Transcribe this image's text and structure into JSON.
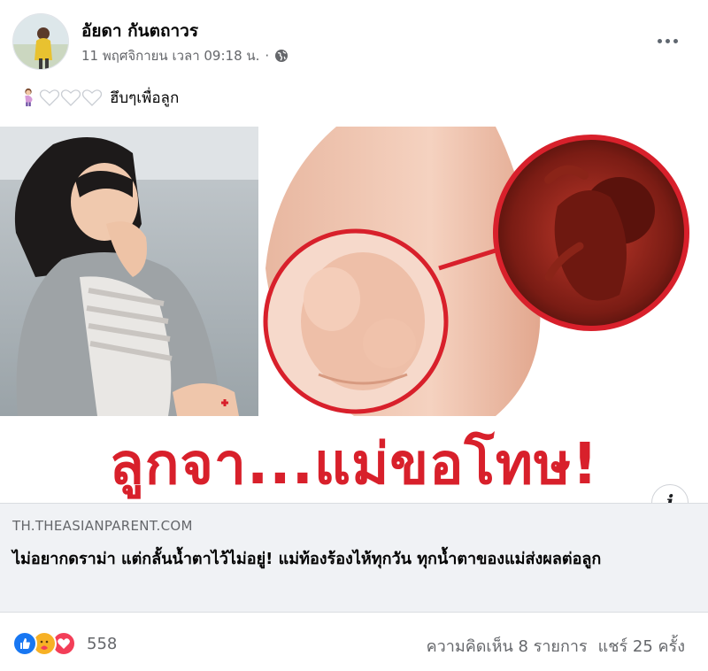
{
  "post": {
    "author": "อัยดา กันตถาวร",
    "timestamp": "11 พฤศจิกายน เวลา 09:18 น.",
    "separator": "·",
    "privacy_icon": "globe-icon",
    "menu_icon": "more-options-icon",
    "caption": {
      "emojis": [
        "pregnant-woman-emoji",
        "white-heart-emoji",
        "white-heart-emoji",
        "white-heart-emoji"
      ],
      "text": "ฮึบๆเพื่อลูก"
    }
  },
  "media": {
    "headline": "ลูกจา...แม่ขอโทษ!",
    "headline_color": "#d8202b",
    "info_icon": "info-icon",
    "info_label": "i"
  },
  "link_preview": {
    "domain": "TH.THEASIANPARENT.COM",
    "title": "ไม่อยากดราม่า แต่กลั้นน้ำตาไว้ไม่อยู่! แม่ท้องร้องไห้ทุกวัน ทุกน้ำตาของแม่ส่งผลต่อลูก"
  },
  "footer": {
    "reaction_icons": [
      "like-icon",
      "care-icon",
      "love-icon"
    ],
    "reaction_count": "558",
    "comments": "ความคิดเห็น 8 รายการ",
    "shares": "แชร์ 25 ครั้ง"
  },
  "colors": {
    "accent_red": "#d8202b",
    "like_blue": "#1877f2",
    "love_red": "#f33e58",
    "care_yellow": "#f7b125",
    "secondary_text": "#65676b"
  }
}
